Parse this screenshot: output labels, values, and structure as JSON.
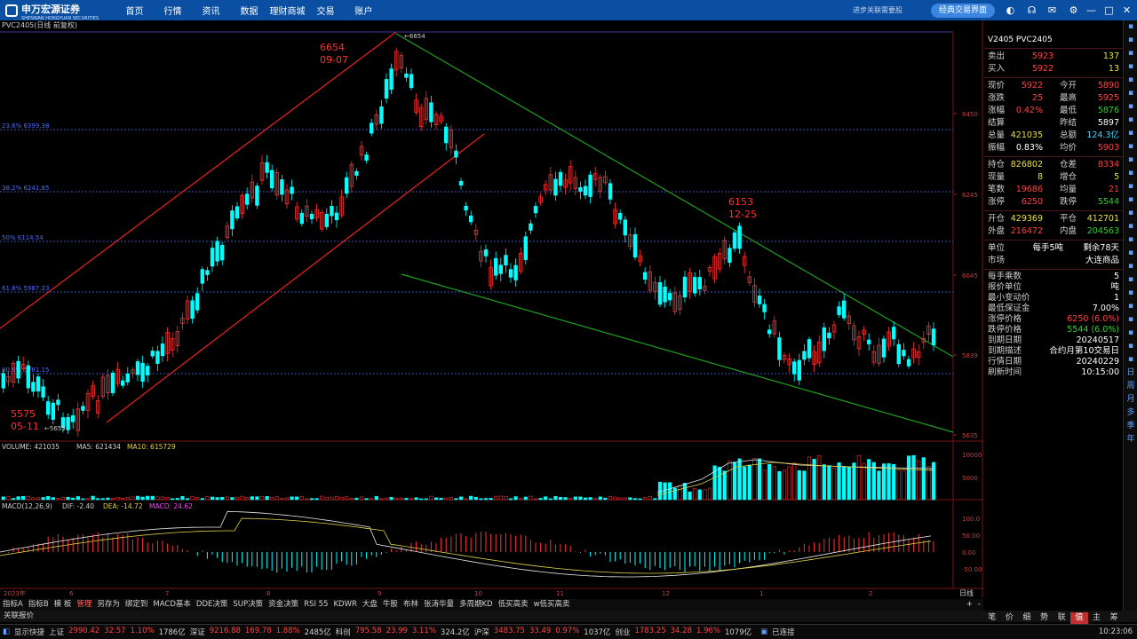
{
  "topbar": {
    "logo_cn": "申万宏源证券",
    "logo_en": "SHENWAN HONGYUAN SECURITIES",
    "menu": [
      "首页",
      "行情",
      "资讯",
      "数据",
      "理财商城",
      "交易",
      "账户"
    ],
    "slogan": "进步关联需要股",
    "classic": "经典交易界面"
  },
  "chart_title": "PVC2405(日线 前复权)",
  "annotations": {
    "high_price": "6654",
    "high_date": "09-07",
    "high_tag": "6654",
    "mid_price": "6153",
    "mid_date": "12-25",
    "low_price": "5575",
    "low_date": "05-11",
    "low_tag": "5655"
  },
  "fib": [
    "23.6% 6399.38",
    "38.2% 6241.85",
    "50% 6114.54",
    "61.8% 5987.23",
    "80.9% 5781.15"
  ],
  "price_axis": [
    "6450",
    "6245",
    "6045",
    "5839",
    "5635"
  ],
  "volume_label": {
    "name": "VOLUME: 421035",
    "ma5": "MA5: 621434",
    "ma10": "MA10: 615729"
  },
  "volume_axis": [
    "10000",
    "5000"
  ],
  "macd_label": {
    "name": "MACD(12,26,9)",
    "dif": "DIF: -2.40",
    "dea": "DEA: -14.72",
    "macd": "MACD: 24.62"
  },
  "macd_axis": [
    "100.0",
    "50.00",
    "0.00",
    "-50.00"
  ],
  "date_axis": [
    "2023年",
    "6",
    "7",
    "8",
    "9",
    "10",
    "11",
    "12",
    "1",
    "2"
  ],
  "period_label": "日线",
  "panel": {
    "header": "V2405 PVC2405",
    "sell_label": "卖出",
    "sell_price": "5923",
    "sell_vol": "137",
    "buy_label": "买入",
    "buy_price": "5922",
    "buy_vol": "13",
    "rows1": [
      {
        "l": "现价",
        "v": "5922",
        "vc": "red",
        "l2": "今开",
        "v2": "5890",
        "v2c": "red"
      },
      {
        "l": "涨跌",
        "v": "25",
        "vc": "red",
        "l2": "最高",
        "v2": "5925",
        "v2c": "red"
      },
      {
        "l": "涨幅",
        "v": "0.42%",
        "vc": "red",
        "l2": "最低",
        "v2": "5876",
        "v2c": "green"
      },
      {
        "l": "结算",
        "v": "",
        "vc": "white",
        "l2": "昨结",
        "v2": "5897",
        "v2c": "white"
      },
      {
        "l": "总量",
        "v": "421035",
        "vc": "yellow",
        "l2": "总额",
        "v2": "124.3亿",
        "v2c": "cyan"
      },
      {
        "l": "振幅",
        "v": "0.83%",
        "vc": "white",
        "l2": "均价",
        "v2": "5903",
        "v2c": "red"
      }
    ],
    "rows2": [
      {
        "l": "持仓",
        "v": "826802",
        "vc": "yellow",
        "l2": "仓差",
        "v2": "8334",
        "v2c": "red"
      },
      {
        "l": "现量",
        "v": "8",
        "vc": "yellow",
        "l2": "增仓",
        "v2": "5",
        "v2c": "yellow"
      },
      {
        "l": "笔数",
        "v": "19686",
        "vc": "red",
        "l2": "均量",
        "v2": "21",
        "v2c": "red"
      },
      {
        "l": "涨停",
        "v": "6250",
        "vc": "red",
        "l2": "跌停",
        "v2": "5544",
        "v2c": "green"
      }
    ],
    "rows3": [
      {
        "l": "开仓",
        "v": "429369",
        "vc": "yellow",
        "l2": "平仓",
        "v2": "412701",
        "v2c": "yellow"
      },
      {
        "l": "外盘",
        "v": "216472",
        "vc": "red",
        "l2": "内盘",
        "v2": "204563",
        "v2c": "green"
      }
    ],
    "unit_l": "单位",
    "unit_a": "每手5吨",
    "unit_b": "剩余78天",
    "market_l": "市场",
    "market_v": "大连商品",
    "kv": [
      {
        "k": "每手乘数",
        "v": "5",
        "c": "white"
      },
      {
        "k": "报价单位",
        "v": "吨",
        "c": "white"
      },
      {
        "k": "最小变动价",
        "v": "1",
        "c": "white"
      },
      {
        "k": "最低保证金",
        "v": "7.00%",
        "c": "white"
      },
      {
        "k": "涨停价格",
        "v": "6250 (6.0%)",
        "c": "red"
      },
      {
        "k": "跌停价格",
        "v": "5544 (6.0%)",
        "c": "green"
      },
      {
        "k": "到期日期",
        "v": "20240517",
        "c": "white"
      },
      {
        "k": "到期描述",
        "v": "合约月第10交易日",
        "c": "white"
      },
      {
        "k": "行情日期",
        "v": "20240229",
        "c": "white"
      },
      {
        "k": "刷新时间",
        "v": "10:15:00",
        "c": "white"
      }
    ]
  },
  "right_tabs": [
    "日",
    "周",
    "月",
    "多",
    "季",
    "年"
  ],
  "tabs": [
    "指标A",
    "指标B",
    "模 板",
    "管理",
    "另存为",
    "绑定到",
    "MACD基本",
    "DDE决策",
    "SUP决策",
    "资金决策",
    "RSI 55",
    "KDWR",
    "大盘",
    "牛股",
    "布林",
    "张涛华量",
    "多周期KD",
    "低买高卖",
    "w低买高卖"
  ],
  "active_tab": "管理",
  "bottom_left": "关联报价",
  "panel_tabs": [
    "笔",
    "价",
    "细",
    "势",
    "联",
    "值",
    "主",
    "筹"
  ],
  "active_panel_tab": "值",
  "status": {
    "display": "显示快捷",
    "items": [
      {
        "t": "上证",
        "c": "white"
      },
      {
        "t": "2990.42",
        "c": "red"
      },
      {
        "t": "32.57",
        "c": "red"
      },
      {
        "t": "1.10%",
        "c": "red"
      },
      {
        "t": "1786亿",
        "c": "white"
      },
      {
        "t": "深证",
        "c": "white"
      },
      {
        "t": "9216.88",
        "c": "red"
      },
      {
        "t": "169.78",
        "c": "red"
      },
      {
        "t": "1.88%",
        "c": "red"
      },
      {
        "t": "2485亿",
        "c": "white"
      },
      {
        "t": "科创",
        "c": "white"
      },
      {
        "t": "795.58",
        "c": "red"
      },
      {
        "t": "23.99",
        "c": "red"
      },
      {
        "t": "3.11%",
        "c": "red"
      },
      {
        "t": "324.2亿",
        "c": "white"
      },
      {
        "t": "沪深",
        "c": "white"
      },
      {
        "t": "3483.75",
        "c": "red"
      },
      {
        "t": "33.49",
        "c": "red"
      },
      {
        "t": "0.97%",
        "c": "red"
      },
      {
        "t": "1037亿",
        "c": "white"
      },
      {
        "t": "创业",
        "c": "white"
      },
      {
        "t": "1783.25",
        "c": "red"
      },
      {
        "t": "34.28",
        "c": "red"
      },
      {
        "t": "1.96%",
        "c": "red"
      },
      {
        "t": "1079亿",
        "c": "white"
      }
    ],
    "conn": "已连接",
    "time": "10:23:06"
  },
  "colors": {
    "up": "#ff3030",
    "down": "#00ffff",
    "bg": "#000000",
    "fib": "#4a6aff"
  }
}
